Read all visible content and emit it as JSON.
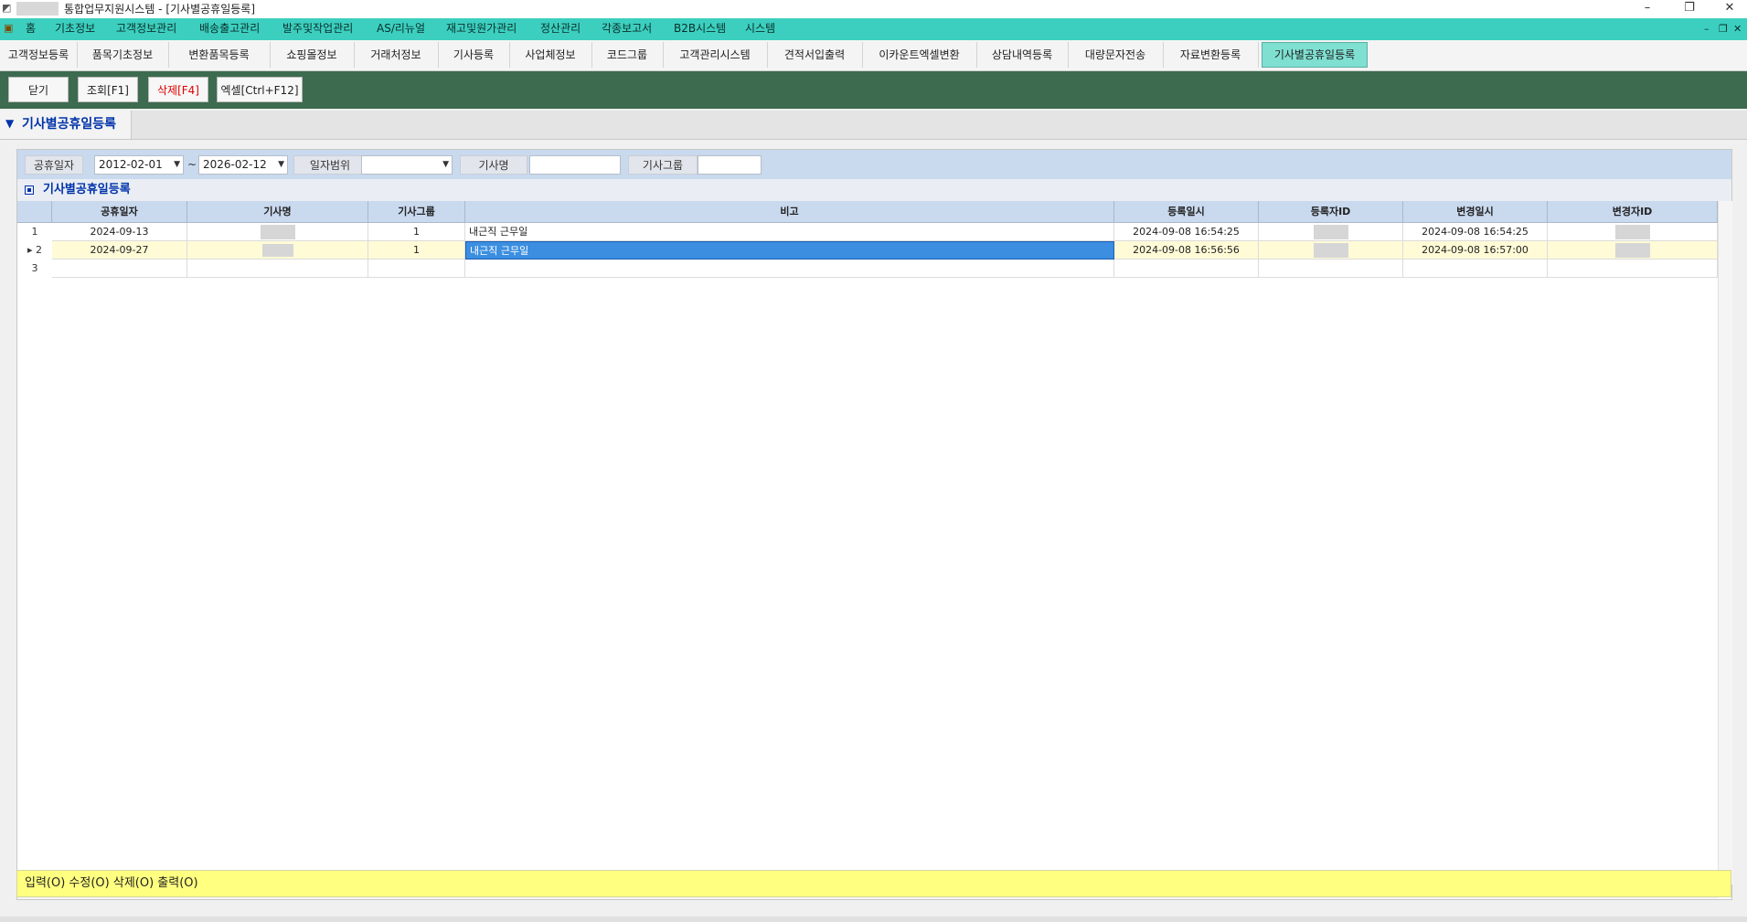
{
  "window": {
    "title": "통합업무지원시스템 - [기사별공휴일등록]",
    "controls": {
      "minimize": "–",
      "restore": "❐",
      "close": "✕"
    }
  },
  "menubar": {
    "items": [
      "홈",
      "기초정보",
      "고객정보관리",
      "배송출고관리",
      "발주및작업관리",
      "AS/리뉴얼",
      "재고및원가관리",
      "정산관리",
      "각종보고서",
      "B2B시스템",
      "시스템"
    ],
    "mdi_controls": {
      "minimize": "–",
      "restore": "❐",
      "close": "✕"
    }
  },
  "tabs": [
    "고객정보등록",
    "품목기초정보",
    "변환품목등록",
    "쇼핑몰정보",
    "거래처정보",
    "기사등록",
    "사업체정보",
    "코드그룹",
    "고객관리시스템",
    "견적서입출력",
    "이카운트엑셀변환",
    "상담내역등록",
    "대량문자전송",
    "자료변환등록",
    "기사별공휴일등록"
  ],
  "active_tab": "기사별공휴일등록",
  "toolbar": {
    "close_label": "닫기",
    "search_label": "조회[F1]",
    "delete_label": "삭제[F4]",
    "excel_label": "엑셀[Ctrl+F12]"
  },
  "section": {
    "arrow": "▼",
    "title": "기사별공휴일등록"
  },
  "filters": {
    "holiday_date_label": "공휴일자",
    "date_from": "2012-02-01",
    "date_to": "2026-02-12",
    "tilde": "~",
    "date_range_label": "일자범위",
    "date_range_value": "",
    "driver_name_label": "기사명",
    "driver_name_value": "",
    "driver_group_label": "기사그룹",
    "driver_group_value": ""
  },
  "grid": {
    "title": "기사별공휴일등록",
    "columns": [
      "공휴일자",
      "기사명",
      "기사그룹",
      "비고",
      "등록일시",
      "등록자ID",
      "변경일시",
      "변경자ID"
    ],
    "rows": [
      {
        "num": "1",
        "indicator": "",
        "date": "2024-09-13",
        "group": "1",
        "note": "내근직 근무일",
        "reg_time": "2024-09-08 16:54:25",
        "mod_time": "2024-09-08 16:54:25"
      },
      {
        "num": "2",
        "indicator": "▸",
        "date": "2024-09-27",
        "group": "1",
        "note": "내근직 근무일",
        "reg_time": "2024-09-08 16:56:56",
        "mod_time": "2024-09-08 16:57:00"
      },
      {
        "num": "3",
        "indicator": "",
        "date": "",
        "group": "",
        "note": "",
        "reg_time": "",
        "mod_time": ""
      }
    ]
  },
  "status_bar": "입력(O) 수정(O) 삭제(O) 출력(O)",
  "colors": {
    "menubar": "#3ccfbf",
    "toolbar": "#3c6b4f",
    "active_tab": "#7fe0d2",
    "grid_header": "#c9d9ee",
    "selected_cell": "#3b8ee0",
    "selected_row": "#fffbd6",
    "status_bar": "#ffff80",
    "delete_text": "#e00000"
  }
}
